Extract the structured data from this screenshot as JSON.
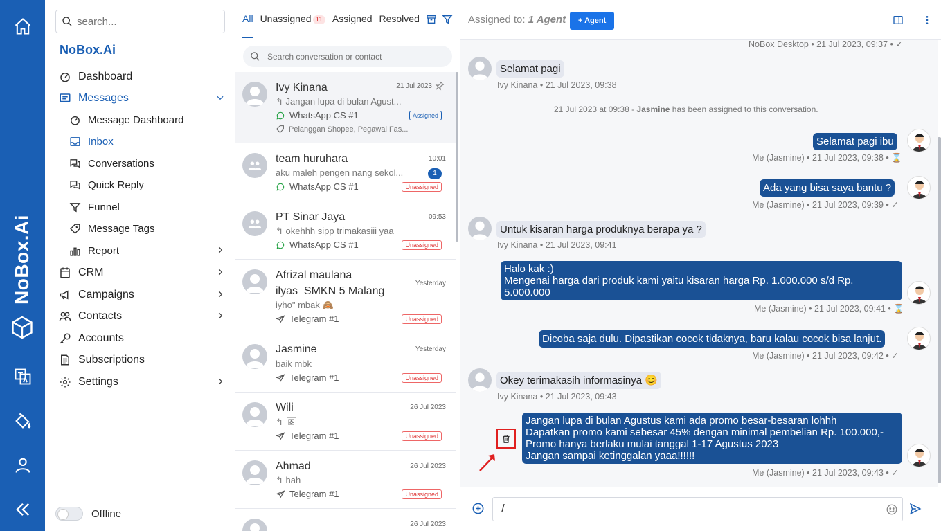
{
  "brand": {
    "name": "NoBox.Ai",
    "vertical": "NoBox.Ai"
  },
  "search": {
    "placeholder": "search..."
  },
  "nav": {
    "dashboard": "Dashboard",
    "messages": "Messages",
    "message_dashboard": "Message Dashboard",
    "inbox": "Inbox",
    "conversations": "Conversations",
    "quick_reply": "Quick Reply",
    "funnel": "Funnel",
    "message_tags": "Message Tags",
    "report": "Report",
    "crm": "CRM",
    "campaigns": "Campaigns",
    "contacts": "Contacts",
    "accounts": "Accounts",
    "subscriptions": "Subscriptions",
    "settings": "Settings",
    "status": "Offline"
  },
  "tabs": {
    "all": "All",
    "unassigned": "Unassigned",
    "unassigned_count": "11",
    "assigned": "Assigned",
    "resolved": "Resolved"
  },
  "conv_search": {
    "placeholder": "Search conversation or contact"
  },
  "conversations": [
    {
      "name": "Ivy Kinana",
      "time": "21 Jul 2023",
      "preview": "Jangan lupa di bulan Agust...",
      "channel": "WhatsApp CS #1",
      "status": "Assigned",
      "tags": "Pelanggan Shopee, Pegawai Fas..."
    },
    {
      "name": "team huruhara",
      "time": "10:01",
      "preview": "aku maleh pengen nang sekol...",
      "channel": "WhatsApp CS #1",
      "status": "Unassigned",
      "unread": "1"
    },
    {
      "name": "PT Sinar Jaya",
      "time": "09:53",
      "preview": "okehhh sipp trimakasiii yaa",
      "channel": "WhatsApp CS #1",
      "status": "Unassigned"
    },
    {
      "name": "Afrizal maulana ilyas_SMKN 5 Malang",
      "time": "Yesterday",
      "preview": "iyho\" mbak 🙈",
      "channel": "Telegram #1",
      "status": "Unassigned"
    },
    {
      "name": "Jasmine",
      "time": "Yesterday",
      "preview": "baik mbk",
      "channel": "Telegram #1",
      "status": "Unassigned"
    },
    {
      "name": "Wili",
      "time": "26 Jul 2023",
      "preview": "🖼",
      "channel": "Telegram #1",
      "status": "Unassigned"
    },
    {
      "name": "Ahmad",
      "time": "26 Jul 2023",
      "preview": "hah",
      "channel": "Telegram #1",
      "status": "Unassigned"
    },
    {
      "name": "",
      "time": "26 Jul 2023"
    }
  ],
  "chat": {
    "assigned_label": "Assigned to:",
    "assigned_value": "1 Agent",
    "agent_button": "+ Agent",
    "top_meta": "NoBox Desktop • 21 Jul 2023, 09:37 •",
    "system": {
      "date": "21 Jul 2023 at 09:38 - ",
      "who": "Jasmine",
      "rest": " has been assigned to this conversation."
    },
    "messages": [
      {
        "text": "Selamat pagi",
        "meta": "Ivy Kinana • 21 Jul 2023, 09:38"
      },
      {
        "text": "Selamat pagi ibu",
        "meta": "Me (Jasmine) • 21 Jul 2023, 09:38 • ⌛"
      },
      {
        "text": "Ada yang bisa saya bantu ?",
        "meta": "Me (Jasmine) • 21 Jul 2023, 09:39 • ✓"
      },
      {
        "text": "Untuk kisaran harga produknya berapa ya ?",
        "meta": "Ivy Kinana • 21 Jul 2023, 09:41"
      },
      {
        "lines": [
          "Halo kak :)",
          "Mengenai harga dari produk kami yaitu kisaran harga Rp. 1.000.000 s/d Rp.",
          "5.000.000"
        ],
        "meta": "Me (Jasmine) • 21 Jul 2023, 09:41 • ⌛"
      },
      {
        "text": "Dicoba saja dulu. Dipastikan cocok tidaknya, baru kalau cocok bisa lanjut.",
        "meta": "Me (Jasmine) • 21 Jul 2023, 09:42 • ✓"
      },
      {
        "text": "Okey terimakasih informasinya 😊",
        "meta": "Ivy Kinana • 21 Jul 2023, 09:43"
      },
      {
        "lines": [
          "Jangan lupa di bulan Agustus kami ada promo besar-besaran lohhh",
          "Dapatkan promo kami sebesar 45% dengan minimal pembelian Rp. 100.000,-",
          "Promo hanya berlaku mulai tanggal 1-17 Agustus 2023",
          "Jangan sampai ketinggalan yaaa!!!!!!"
        ],
        "meta": "Me (Jasmine) • 21 Jul 2023, 09:43 • ✓"
      }
    ]
  },
  "composer": {
    "value": "/"
  },
  "colors": {
    "primary": "#1a5fb4",
    "bubble_out": "#1a5195",
    "bubble_in": "#e4e7ef",
    "danger": "#e02020"
  }
}
